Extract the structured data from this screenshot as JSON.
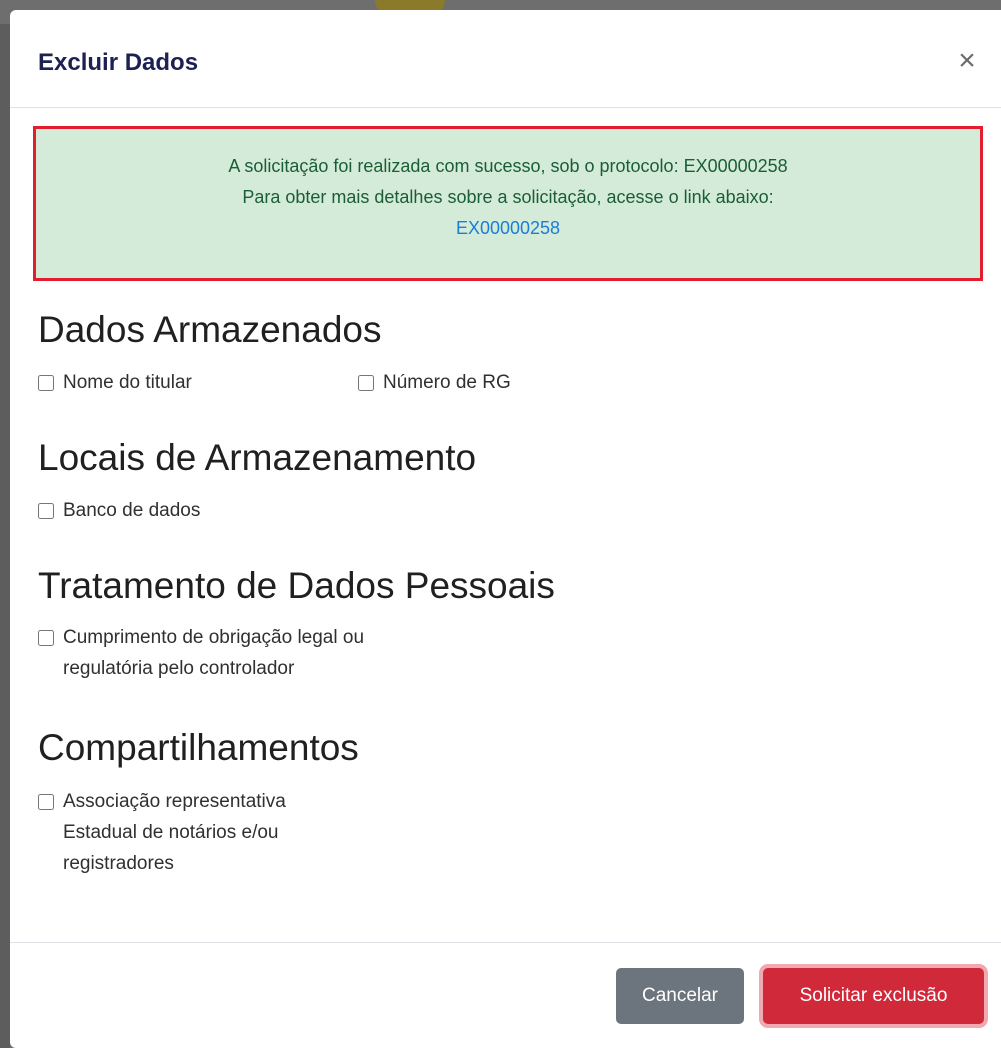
{
  "modal": {
    "title": "Excluir Dados",
    "close_symbol": "×"
  },
  "alert": {
    "line1": "A solicitação foi realizada com sucesso, sob o protocolo: EX00000258",
    "line2": "Para obter mais detalhes sobre a solicitação, acesse o link abaixo:",
    "link_text": "EX00000258"
  },
  "sections": [
    {
      "title": "Dados Armazenados",
      "items": [
        "Nome do titular",
        "Número de RG"
      ]
    },
    {
      "title": "Locais de Armazenamento",
      "items": [
        "Banco de dados"
      ]
    },
    {
      "title": "Tratamento de Dados Pessoais",
      "items": [
        "Cumprimento de obrigação legal ou\nregulatória pelo controlador"
      ]
    },
    {
      "title": "Compartilhamentos",
      "items": [
        "Associação representativa\nEstadual de notários e/ou\nregistradores"
      ]
    }
  ],
  "footer": {
    "cancel_label": "Cancelar",
    "submit_label": "Solicitar exclusão"
  },
  "colors": {
    "alert_bg": "#d4ebd9",
    "alert_border": "#e11d2e",
    "alert_text": "#1a5e35",
    "link": "#1a7dd6",
    "cancel_bg": "#6c757d",
    "submit_bg": "#d0293a",
    "title": "#1c2152"
  }
}
